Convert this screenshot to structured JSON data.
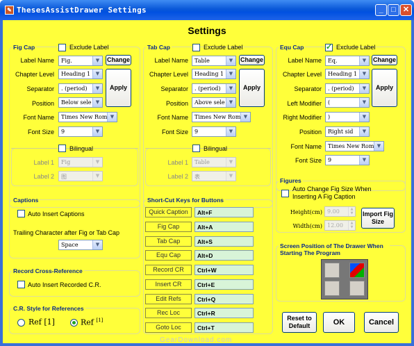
{
  "window": {
    "title": "ThesesAssistDrawer Settings",
    "min": "_",
    "max": "□",
    "close": "✕",
    "icon": "app-icon"
  },
  "heading": "Settings",
  "fig": {
    "title": "Fig Cap",
    "exclude": "Exclude Label",
    "labels": {
      "name": "Label Name",
      "chapter": "Chapter Level",
      "sep": "Separator",
      "pos": "Position",
      "font": "Font Name",
      "size": "Font Size"
    },
    "values": {
      "name": "Fig.",
      "chapter": "Heading 1",
      "sep": ". (period)",
      "pos": "Below sele",
      "font": "Times New Roma",
      "size": "9"
    },
    "change": "Change",
    "apply": "Apply",
    "bilingual": "Bilingual",
    "label1": "Label 1",
    "label2": "Label 2",
    "label1_val": "Fig",
    "label2_val": "图"
  },
  "tab": {
    "title": "Tab Cap",
    "exclude": "Exclude Label",
    "labels": {
      "name": "Label Name",
      "chapter": "Chapter Level",
      "sep": "Separator",
      "pos": "Position",
      "font": "Font Name",
      "size": "Font Size"
    },
    "values": {
      "name": "Table",
      "chapter": "Heading 1",
      "sep": ". (period)",
      "pos": "Above sele",
      "font": "Times New Roma",
      "size": "9"
    },
    "change": "Change",
    "apply": "Apply",
    "bilingual": "Bilingual",
    "label1": "Label 1",
    "label2": "Label 2",
    "label1_val": "Table",
    "label2_val": "表"
  },
  "equ": {
    "title": "Equ Cap",
    "exclude": "Exclude Label",
    "labels": {
      "name": "Label Name",
      "chapter": "Chapter Level",
      "sep": "Separator",
      "lmod": "Left Modifier",
      "rmod": "Right Modifier",
      "pos": "Position",
      "font": "Font Name",
      "size": "Font Size"
    },
    "values": {
      "name": "Eq.",
      "chapter": "Heading 1",
      "sep": ". (period)",
      "lmod": "(",
      "rmod": ")",
      "pos": "Right sid",
      "font": "Times New Roma",
      "size": "9"
    },
    "change": "Change",
    "apply": "Apply"
  },
  "captions": {
    "title": "Captions",
    "auto": "Auto Insert Captions",
    "trailing": "Trailing Character after Fig or Tab Cap",
    "trailing_val": "Space"
  },
  "record": {
    "title": "Record Cross-Reference",
    "auto": "Auto Insert Recorded C.R."
  },
  "crstyle": {
    "title": "C.R. Style for References",
    "opt1": "Ref [1]",
    "opt2": "Ref",
    "opt2_sup": "[1]"
  },
  "shortcuts": {
    "title": "Short-Cut Keys for Buttons",
    "items": [
      {
        "name": "Quick Caption",
        "key": "Alt+F"
      },
      {
        "name": "Fig Cap",
        "key": "Alt+A"
      },
      {
        "name": "Tab Cap",
        "key": "Alt+S"
      },
      {
        "name": "Equ Cap",
        "key": "Alt+D"
      },
      {
        "name": "Record CR",
        "key": "Ctrl+W"
      },
      {
        "name": "Insert CR",
        "key": "Ctrl+E"
      },
      {
        "name": "Edit Refs",
        "key": "Ctrl+Q"
      },
      {
        "name": "Rec Loc",
        "key": "Ctrl+R"
      },
      {
        "name": "Goto Loc",
        "key": "Ctrl+T"
      }
    ]
  },
  "figures": {
    "title": "Figures",
    "auto": "Auto Change Fig Size When Inserting A Fig Caption",
    "height": "Height(cm)",
    "width": "Width(cm)",
    "height_val": "9.00",
    "width_val": "12.00",
    "import": "Import Fig Size"
  },
  "screenpos": {
    "title": "Screen Position of The Drawer When Starting The Program"
  },
  "buttons": {
    "reset": "Reset to Default",
    "ok": "OK",
    "cancel": "Cancel"
  },
  "watermark": "GearDownload.com",
  "colors": {
    "background": "#ffff3a",
    "title_bar": "#0a58d8",
    "group_title": "#0a2a8a"
  }
}
